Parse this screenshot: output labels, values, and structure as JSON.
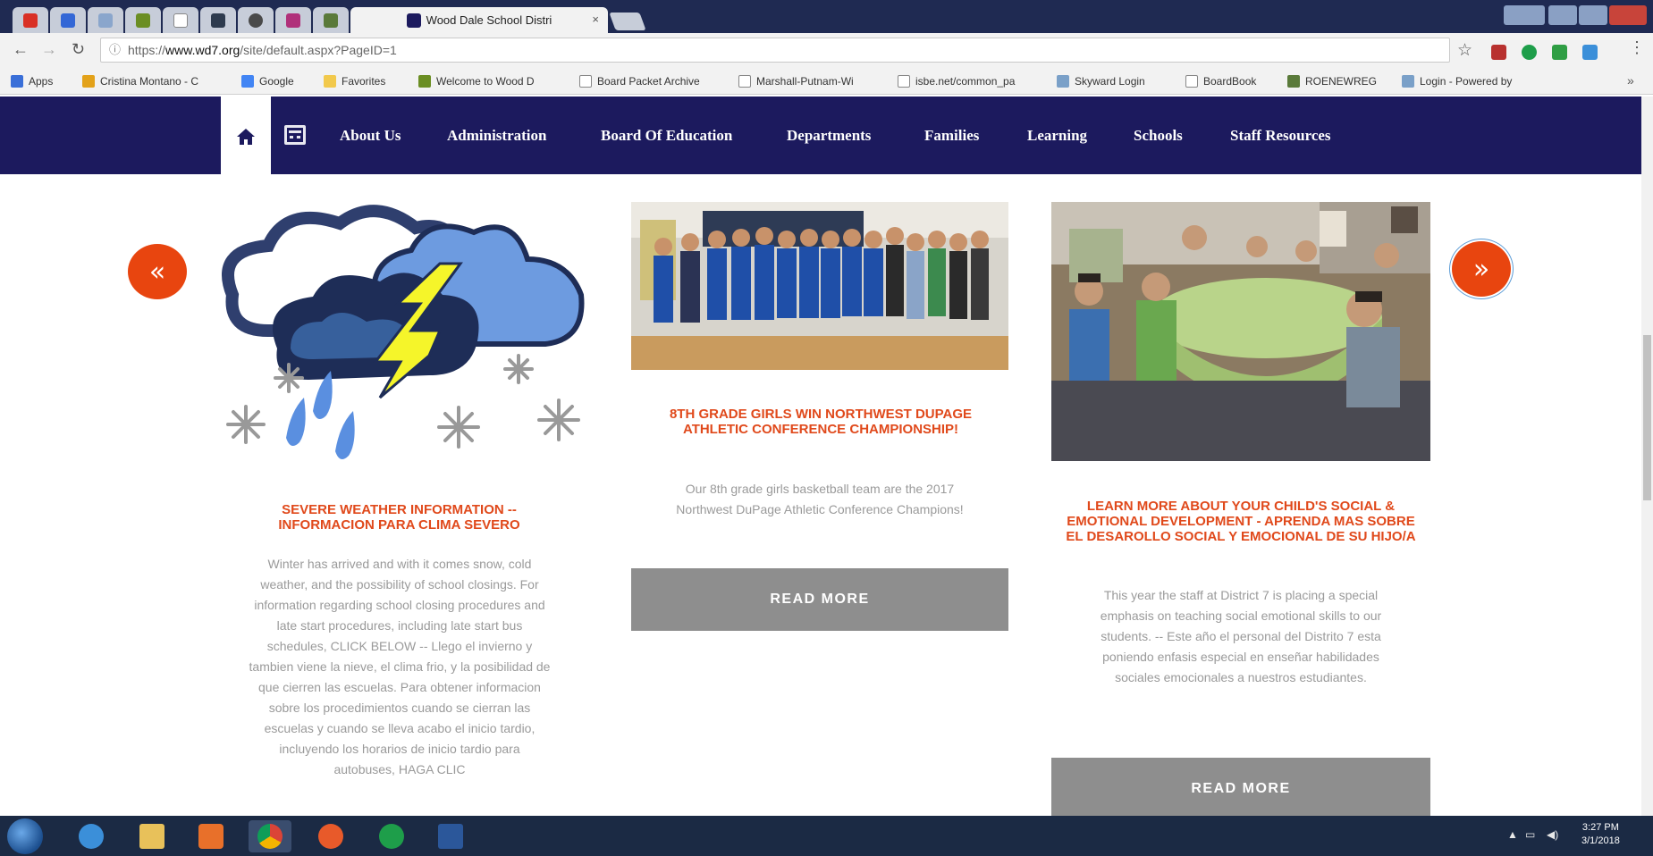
{
  "browser": {
    "active_tab_title": "Wood Dale School Distri",
    "tab_close": "×",
    "url_scheme": "https://",
    "url_host": "www.wd7.org",
    "url_path": "/site/default.aspx?PageID=1",
    "bookmarks": [
      {
        "label": "Apps",
        "icon": "apps-grid-icon",
        "color": "#3a6fd8"
      },
      {
        "label": "Cristina Montano - C",
        "icon": "person-icon",
        "color": "#e3a21a"
      },
      {
        "label": "Google",
        "icon": "google-icon",
        "color": "#4285f4"
      },
      {
        "label": "Favorites",
        "icon": "folder-icon",
        "color": "#f2c94c"
      },
      {
        "label": "Welcome to Wood D",
        "icon": "site-icon",
        "color": "#6b8e23"
      },
      {
        "label": "Board Packet Archive",
        "icon": "page-icon",
        "color": "#bbbbbb"
      },
      {
        "label": "Marshall-Putnam-Wi",
        "icon": "page-icon",
        "color": "#bbbbbb"
      },
      {
        "label": "isbe.net/common_pa",
        "icon": "page-icon",
        "color": "#bbbbbb"
      },
      {
        "label": "Skyward Login",
        "icon": "chart-icon",
        "color": "#7aa0c8"
      },
      {
        "label": "BoardBook",
        "icon": "page-icon",
        "color": "#bbbbbb"
      },
      {
        "label": "ROENEWREG",
        "icon": "landscape-icon",
        "color": "#5a7a3a"
      },
      {
        "label": "Login - Powered by",
        "icon": "chart-icon",
        "color": "#7aa0c8"
      }
    ],
    "bookmarks_more": "»"
  },
  "site_nav": {
    "items": [
      "About Us",
      "Administration",
      "Board Of Education",
      "Departments",
      "Families",
      "Learning",
      "Schools",
      "Staff Resources"
    ],
    "home_glyph": "⌂"
  },
  "carousel": {
    "prev_glyph": "«",
    "next_glyph": "»",
    "cards": [
      {
        "title": "SEVERE WEATHER INFORMATION -- INFORMACION PARA CLIMA SEVERO",
        "body": "Winter has arrived and with it comes snow, cold weather, and the possibility of school closings. For information regarding school closing procedures and late start procedures, including late start bus schedules, CLICK BELOW -- Llego el invierno y tambien viene la nieve, el clima frio, y la posibilidad de que cierren las escuelas. Para obtener informacion sobre los procedimientos cuando se cierran las escuelas y cuando se lleva acabo el inicio tardio, incluyendo los horarios de inicio tardio para autobuses, HAGA CLIC"
      },
      {
        "title": "8TH GRADE GIRLS WIN NORTHWEST DUPAGE ATHLETIC CONFERENCE CHAMPIONSHIP!",
        "body": "Our 8th grade girls basketball team are the 2017 Northwest DuPage Athletic Conference Champions!",
        "button": "READ MORE"
      },
      {
        "title": "LEARN MORE ABOUT YOUR CHILD'S SOCIAL & EMOTIONAL DEVELOPMENT - APRENDA MAS SOBRE EL DESAROLLO SOCIAL Y EMOCIONAL DE SU HIJO/A",
        "body": "This year the staff at District 7 is placing a special emphasis on teaching social emotional skills to our students. -- Este año el personal del Distrito 7 esta poniendo enfasis especial en enseñar habilidades sociales emocionales a nuestros estudiantes.",
        "button": "READ MORE"
      }
    ]
  },
  "taskbar": {
    "time": "3:27 PM",
    "date": "3/1/2018"
  },
  "colors": {
    "nav_bg": "#1c1a5e",
    "accent_orange": "#e8450f",
    "title_orange": "#e0491b",
    "button_gray": "#8e8e8e",
    "body_gray": "#9a9a9a"
  }
}
